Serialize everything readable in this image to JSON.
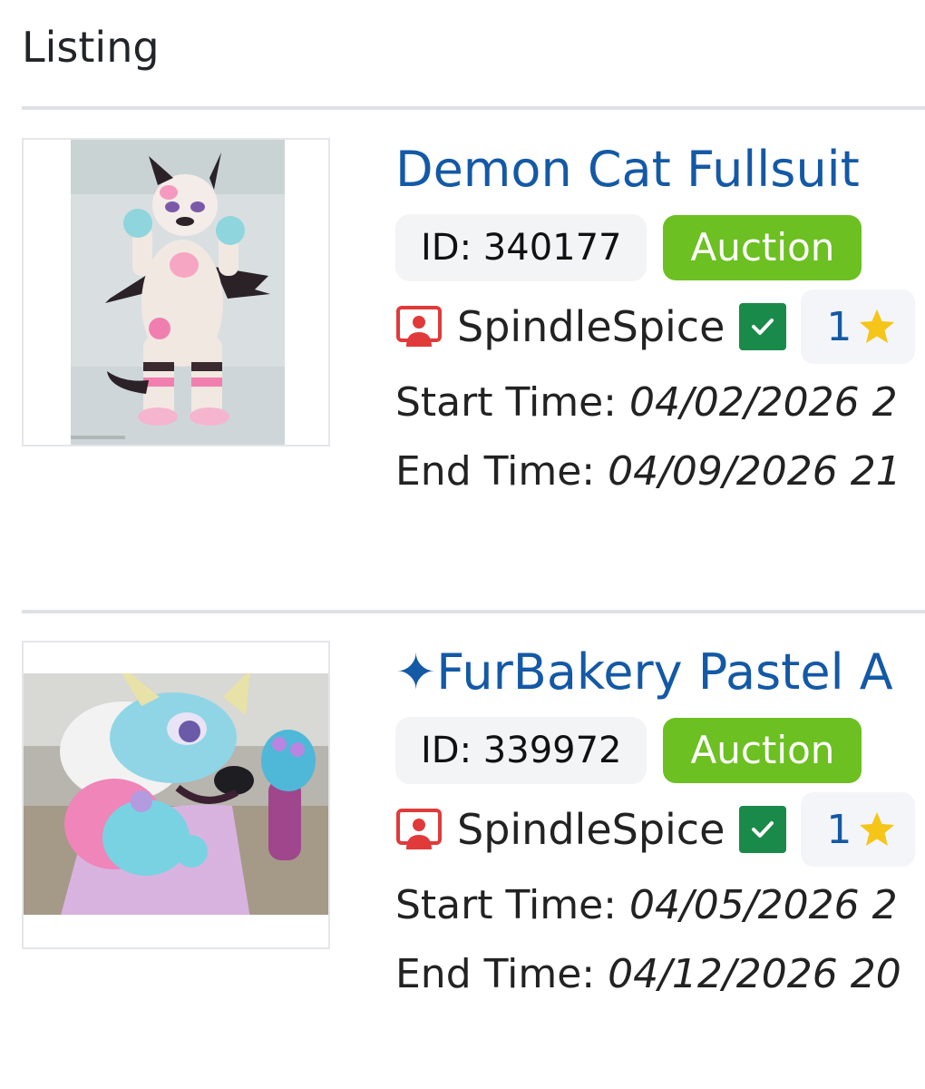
{
  "header": {
    "title": "Listing"
  },
  "listings": [
    {
      "title": "Demon Cat Fullsuit",
      "id_label": "ID: 340177",
      "type": "Auction",
      "seller": "SpindleSpice",
      "rating_count": "1",
      "start_label": "Start Time:",
      "start_time": "04/02/2026 2",
      "end_label": "End Time:",
      "end_time": "04/09/2026 21"
    },
    {
      "title": "✦FurBakery Pastel A",
      "id_label": "ID: 339972",
      "type": "Auction",
      "seller": "SpindleSpice",
      "rating_count": "1",
      "start_label": "Start Time:",
      "start_time": "04/05/2026 2",
      "end_label": "End Time:",
      "end_time": "04/12/2026 20"
    }
  ],
  "colors": {
    "title": "#1459a6",
    "auction_badge": "#6cc021",
    "verified": "#1a8a4a",
    "seller_icon": "#e03a3a",
    "star": "#f5c518"
  }
}
